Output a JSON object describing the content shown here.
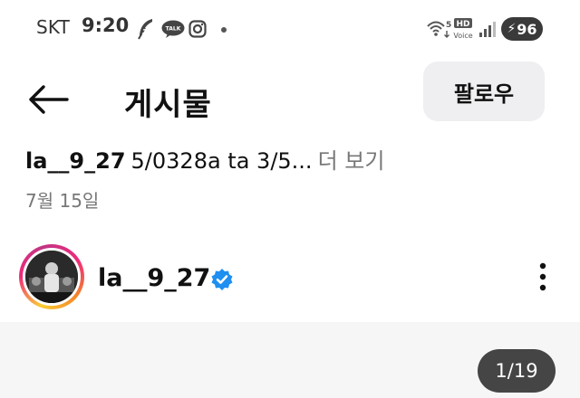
{
  "status_bar": {
    "carrier": "SKT",
    "time": "9:20",
    "talk_label": "TALK",
    "network_label": "5",
    "voice_hd": "HD",
    "voice_label": "Voice",
    "battery": "96",
    "icons": [
      "feather-icon",
      "kakaotalk-icon",
      "instagram-icon",
      "wifi-icon",
      "hd-voice-icon",
      "signal-icon",
      "battery-charging-icon"
    ]
  },
  "header": {
    "title": "게시물",
    "follow_label": "팔로우"
  },
  "caption": {
    "username": "la__9_27",
    "text": "5/0328a ta 3/5...",
    "more_label": "더 보기",
    "date": "7월 15일"
  },
  "author": {
    "username": "la__9_27",
    "verified": true
  },
  "media": {
    "counter": "1/19"
  },
  "colors": {
    "verified_blue": "#1f8ff0",
    "follow_bg": "#efeff1",
    "muted_text": "#777777",
    "counter_bg": "#454545"
  }
}
